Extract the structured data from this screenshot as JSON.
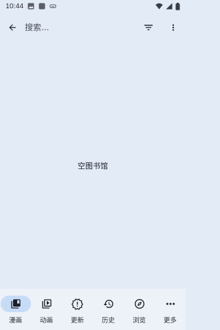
{
  "status_bar": {
    "time": "10:44"
  },
  "search": {
    "placeholder": "搜索..."
  },
  "main": {
    "empty_message": "空图书馆"
  },
  "bottom_nav": {
    "items": [
      {
        "label": "漫画",
        "icon": "library-icon",
        "active": true
      },
      {
        "label": "动画",
        "icon": "video-library-icon",
        "active": false
      },
      {
        "label": "更新",
        "icon": "new-releases-icon",
        "active": false
      },
      {
        "label": "历史",
        "icon": "history-icon",
        "active": false
      },
      {
        "label": "浏览",
        "icon": "compass-icon",
        "active": false
      },
      {
        "label": "更多",
        "icon": "more-horiz-icon",
        "active": false
      }
    ]
  },
  "colors": {
    "background": "#e3ebf7",
    "nav_background": "#edf1f8",
    "active_pill": "#c6dcf6",
    "text": "#1b1f27"
  }
}
